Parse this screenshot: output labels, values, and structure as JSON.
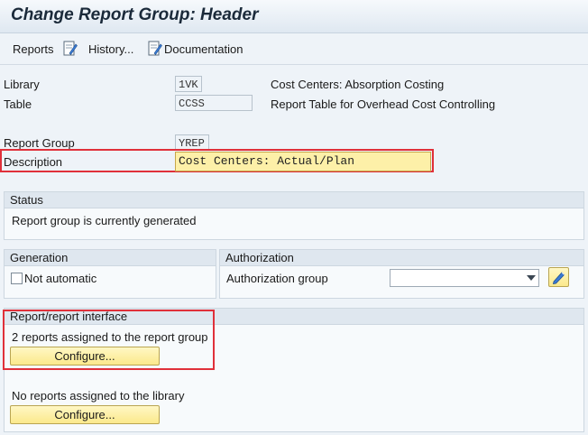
{
  "window": {
    "title": "Change Report Group: Header"
  },
  "toolbar": {
    "reports_label": "Reports",
    "history_label": "History...",
    "documentation_label": "Documentation"
  },
  "header_fields": {
    "library_label": "Library",
    "library_value": "1VK",
    "library_text": "Cost Centers: Absorption Costing",
    "table_label": "Table",
    "table_value": "CCSS",
    "table_text": "Report Table for Overhead Cost Controlling",
    "report_group_label": "Report Group",
    "report_group_value": "YREP",
    "description_label": "Description",
    "description_value": "Cost Centers: Actual/Plan"
  },
  "status": {
    "heading": "Status",
    "text": "Report group is currently generated"
  },
  "generation": {
    "heading": "Generation",
    "not_automatic_label": "Not automatic"
  },
  "authorization": {
    "heading": "Authorization",
    "group_label": "Authorization group",
    "group_value": ""
  },
  "report_interface": {
    "heading": "Report/report interface",
    "assigned_group_text": "2 reports assigned to the report group",
    "configure_label": "Configure...",
    "assigned_library_text": "No reports assigned to the library",
    "configure_library_label": "Configure..."
  },
  "colors": {
    "highlight": "#e0303a",
    "button": "#fbe98c",
    "edit_field": "#fdf0a8"
  }
}
